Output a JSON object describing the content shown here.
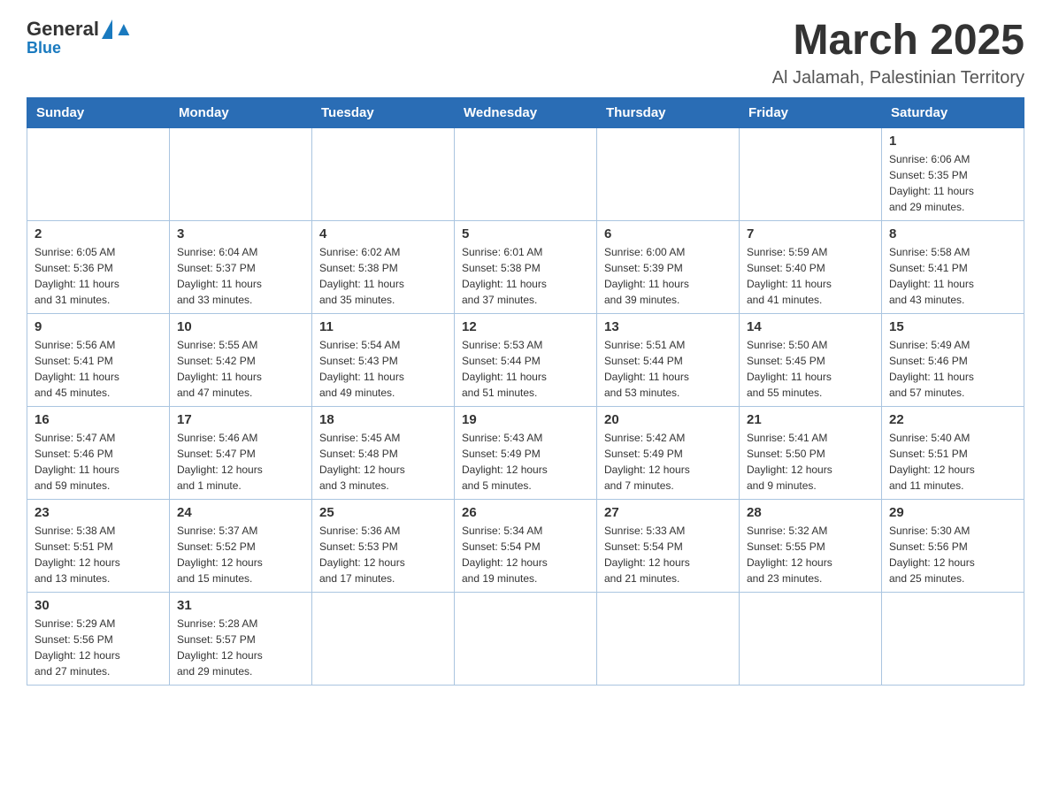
{
  "logo": {
    "general": "General",
    "blue": "Blue"
  },
  "header": {
    "title": "March 2025",
    "subtitle": "Al Jalamah, Palestinian Territory"
  },
  "weekdays": [
    "Sunday",
    "Monday",
    "Tuesday",
    "Wednesday",
    "Thursday",
    "Friday",
    "Saturday"
  ],
  "weeks": [
    [
      {
        "day": "",
        "info": ""
      },
      {
        "day": "",
        "info": ""
      },
      {
        "day": "",
        "info": ""
      },
      {
        "day": "",
        "info": ""
      },
      {
        "day": "",
        "info": ""
      },
      {
        "day": "",
        "info": ""
      },
      {
        "day": "1",
        "info": "Sunrise: 6:06 AM\nSunset: 5:35 PM\nDaylight: 11 hours\nand 29 minutes."
      }
    ],
    [
      {
        "day": "2",
        "info": "Sunrise: 6:05 AM\nSunset: 5:36 PM\nDaylight: 11 hours\nand 31 minutes."
      },
      {
        "day": "3",
        "info": "Sunrise: 6:04 AM\nSunset: 5:37 PM\nDaylight: 11 hours\nand 33 minutes."
      },
      {
        "day": "4",
        "info": "Sunrise: 6:02 AM\nSunset: 5:38 PM\nDaylight: 11 hours\nand 35 minutes."
      },
      {
        "day": "5",
        "info": "Sunrise: 6:01 AM\nSunset: 5:38 PM\nDaylight: 11 hours\nand 37 minutes."
      },
      {
        "day": "6",
        "info": "Sunrise: 6:00 AM\nSunset: 5:39 PM\nDaylight: 11 hours\nand 39 minutes."
      },
      {
        "day": "7",
        "info": "Sunrise: 5:59 AM\nSunset: 5:40 PM\nDaylight: 11 hours\nand 41 minutes."
      },
      {
        "day": "8",
        "info": "Sunrise: 5:58 AM\nSunset: 5:41 PM\nDaylight: 11 hours\nand 43 minutes."
      }
    ],
    [
      {
        "day": "9",
        "info": "Sunrise: 5:56 AM\nSunset: 5:41 PM\nDaylight: 11 hours\nand 45 minutes."
      },
      {
        "day": "10",
        "info": "Sunrise: 5:55 AM\nSunset: 5:42 PM\nDaylight: 11 hours\nand 47 minutes."
      },
      {
        "day": "11",
        "info": "Sunrise: 5:54 AM\nSunset: 5:43 PM\nDaylight: 11 hours\nand 49 minutes."
      },
      {
        "day": "12",
        "info": "Sunrise: 5:53 AM\nSunset: 5:44 PM\nDaylight: 11 hours\nand 51 minutes."
      },
      {
        "day": "13",
        "info": "Sunrise: 5:51 AM\nSunset: 5:44 PM\nDaylight: 11 hours\nand 53 minutes."
      },
      {
        "day": "14",
        "info": "Sunrise: 5:50 AM\nSunset: 5:45 PM\nDaylight: 11 hours\nand 55 minutes."
      },
      {
        "day": "15",
        "info": "Sunrise: 5:49 AM\nSunset: 5:46 PM\nDaylight: 11 hours\nand 57 minutes."
      }
    ],
    [
      {
        "day": "16",
        "info": "Sunrise: 5:47 AM\nSunset: 5:46 PM\nDaylight: 11 hours\nand 59 minutes."
      },
      {
        "day": "17",
        "info": "Sunrise: 5:46 AM\nSunset: 5:47 PM\nDaylight: 12 hours\nand 1 minute."
      },
      {
        "day": "18",
        "info": "Sunrise: 5:45 AM\nSunset: 5:48 PM\nDaylight: 12 hours\nand 3 minutes."
      },
      {
        "day": "19",
        "info": "Sunrise: 5:43 AM\nSunset: 5:49 PM\nDaylight: 12 hours\nand 5 minutes."
      },
      {
        "day": "20",
        "info": "Sunrise: 5:42 AM\nSunset: 5:49 PM\nDaylight: 12 hours\nand 7 minutes."
      },
      {
        "day": "21",
        "info": "Sunrise: 5:41 AM\nSunset: 5:50 PM\nDaylight: 12 hours\nand 9 minutes."
      },
      {
        "day": "22",
        "info": "Sunrise: 5:40 AM\nSunset: 5:51 PM\nDaylight: 12 hours\nand 11 minutes."
      }
    ],
    [
      {
        "day": "23",
        "info": "Sunrise: 5:38 AM\nSunset: 5:51 PM\nDaylight: 12 hours\nand 13 minutes."
      },
      {
        "day": "24",
        "info": "Sunrise: 5:37 AM\nSunset: 5:52 PM\nDaylight: 12 hours\nand 15 minutes."
      },
      {
        "day": "25",
        "info": "Sunrise: 5:36 AM\nSunset: 5:53 PM\nDaylight: 12 hours\nand 17 minutes."
      },
      {
        "day": "26",
        "info": "Sunrise: 5:34 AM\nSunset: 5:54 PM\nDaylight: 12 hours\nand 19 minutes."
      },
      {
        "day": "27",
        "info": "Sunrise: 5:33 AM\nSunset: 5:54 PM\nDaylight: 12 hours\nand 21 minutes."
      },
      {
        "day": "28",
        "info": "Sunrise: 5:32 AM\nSunset: 5:55 PM\nDaylight: 12 hours\nand 23 minutes."
      },
      {
        "day": "29",
        "info": "Sunrise: 5:30 AM\nSunset: 5:56 PM\nDaylight: 12 hours\nand 25 minutes."
      }
    ],
    [
      {
        "day": "30",
        "info": "Sunrise: 5:29 AM\nSunset: 5:56 PM\nDaylight: 12 hours\nand 27 minutes."
      },
      {
        "day": "31",
        "info": "Sunrise: 5:28 AM\nSunset: 5:57 PM\nDaylight: 12 hours\nand 29 minutes."
      },
      {
        "day": "",
        "info": ""
      },
      {
        "day": "",
        "info": ""
      },
      {
        "day": "",
        "info": ""
      },
      {
        "day": "",
        "info": ""
      },
      {
        "day": "",
        "info": ""
      }
    ]
  ]
}
